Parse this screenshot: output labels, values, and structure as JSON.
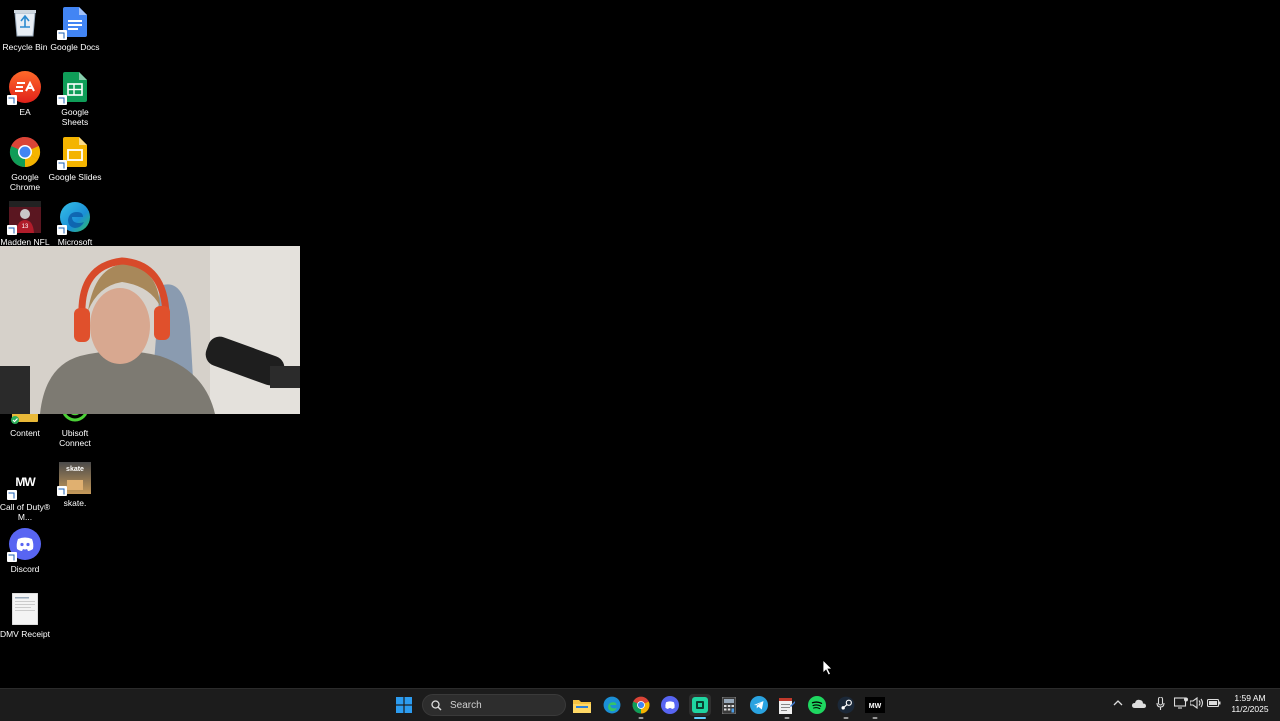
{
  "desktop": {
    "icons": [
      {
        "label": "Recycle Bin",
        "icon": "recycle-bin-icon"
      },
      {
        "label": "Google Docs",
        "icon": "google-docs-icon"
      },
      {
        "label": "EA",
        "icon": "ea-icon"
      },
      {
        "label": "Google Sheets",
        "icon": "google-sheets-icon"
      },
      {
        "label": "Google Chrome",
        "icon": "google-chrome-icon"
      },
      {
        "label": "Google Slides",
        "icon": "google-slides-icon"
      },
      {
        "label": "Madden NFL",
        "icon": "madden-nfl-icon"
      },
      {
        "label": "Microsoft",
        "icon": "microsoft-edge-icon"
      },
      {
        "label": "Content",
        "icon": "content-icon"
      },
      {
        "label": "Ubisoft Connect",
        "icon": "ubisoft-connect-icon"
      },
      {
        "label": "Call of Duty® M...",
        "icon": "call-of-duty-icon"
      },
      {
        "label": "skate.",
        "icon": "skate-icon"
      },
      {
        "label": "Discord",
        "icon": "discord-icon"
      },
      {
        "label": "DMV Receipt",
        "icon": "document-icon"
      }
    ],
    "skate_text": "skate",
    "mw_text": "MW"
  },
  "taskbar": {
    "search_placeholder": "Search",
    "apps": [
      "start-icon",
      "file-explorer-icon",
      "edge-icon",
      "chrome-icon",
      "discord-icon",
      "app-green-icon",
      "calculator-icon",
      "telegram-icon",
      "notepad-icon",
      "spotify-icon",
      "steam-icon",
      "call-of-duty-icon"
    ],
    "clock_time": "1:59 AM",
    "clock_date": "11/2/2025"
  },
  "colors": {
    "taskbar_bg": "#1c1c1c",
    "desktop_bg": "#000000",
    "accent": "#0078d4"
  }
}
